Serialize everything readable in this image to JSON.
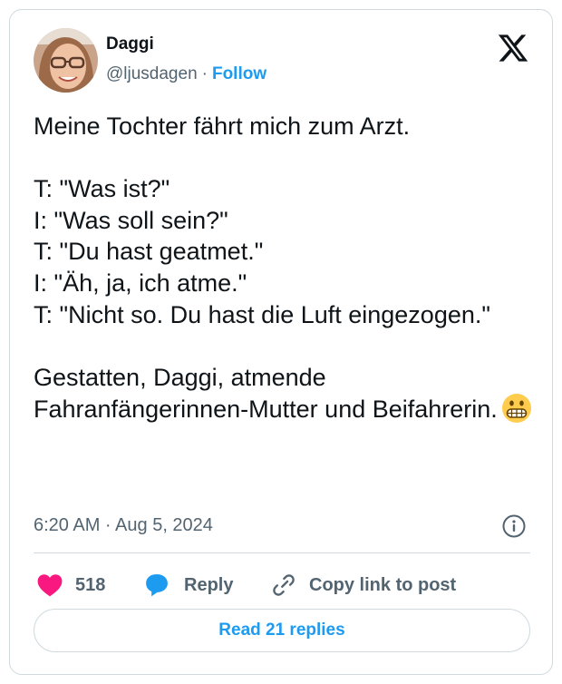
{
  "author": {
    "name": "Daggi",
    "handle": "@ljusdagen",
    "separator": "·",
    "follow_label": "Follow"
  },
  "tweet": {
    "text": "Meine Tochter fährt mich zum Arzt.\n\nT: \"Was ist?\"\nI: \"Was soll sein?\"\nT: \"Du hast geatmet.\"\nI: \"Äh, ja, ich atme.\"\nT: \"Nicht so. Du hast die Luft eingezogen.\"\n\nGestatten, Daggi, atmende Fahranfängerinnen-Mutter und Beifahrerin.",
    "emoji": "grimacing-face-icon",
    "timestamp": "6:20 AM · Aug 5, 2024"
  },
  "actions": {
    "like_count": "518",
    "reply_label": "Reply",
    "copy_link_label": "Copy link to post"
  },
  "read_replies_label": "Read 21 replies",
  "colors": {
    "accent": "#1d9bf0",
    "like": "#f91880",
    "text": "#0f1419",
    "secondary_text": "#536471",
    "border": "#cfd9de"
  }
}
